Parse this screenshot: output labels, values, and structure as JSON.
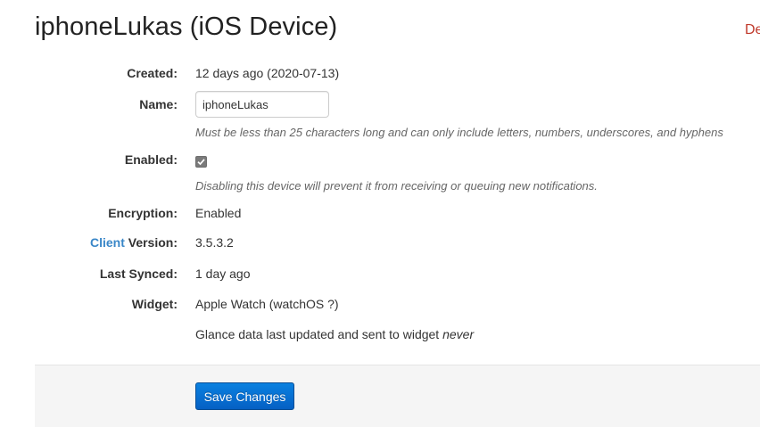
{
  "header": {
    "title": "iphoneLukas (iOS Device)",
    "delete_label": "De"
  },
  "fields": {
    "created": {
      "label": "Created:",
      "value": "12 days ago (2020-07-13)"
    },
    "name": {
      "label": "Name:",
      "value": "iphoneLukas",
      "help": "Must be less than 25 characters long and can only include letters, numbers, underscores, and hyphens"
    },
    "enabled": {
      "label": "Enabled:",
      "checked": true,
      "help": "Disabling this device will prevent it from receiving or queuing new notifications."
    },
    "encryption": {
      "label": "Encryption:",
      "value": "Enabled"
    },
    "client_version": {
      "label_link": "Client",
      "label_rest": " Version:",
      "value": "3.5.3.2"
    },
    "last_synced": {
      "label": "Last Synced:",
      "value": "1 day ago"
    },
    "widget": {
      "label": "Widget:",
      "value": "Apple Watch (watchOS ?)",
      "glance_text": "Glance data last updated and sent to widget ",
      "glance_when": "never"
    }
  },
  "actions": {
    "save_label": "Save Changes"
  },
  "colors": {
    "link": "#3a87c8",
    "danger": "#c0392b",
    "primary": "#0560c4"
  }
}
